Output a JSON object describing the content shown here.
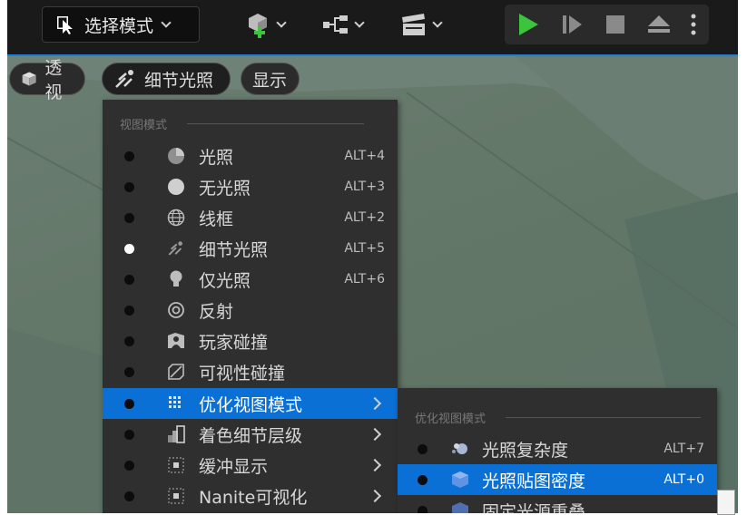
{
  "toolbar": {
    "mode_select_label": "选择模式",
    "icons": [
      "cursor-select-icon",
      "add-actor-icon",
      "blueprint-icon",
      "cinematics-clapper-icon"
    ],
    "play_controls": [
      "play-icon",
      "step-icon",
      "stop-icon",
      "eject-icon",
      "more-vertical-icon"
    ],
    "accent": "#1e7fd8",
    "play_color": "#3cc43c"
  },
  "viewport_chips": {
    "perspective": "透视",
    "lit": "细节光照",
    "show": "显示"
  },
  "view_mode_menu": {
    "header": "视图模式",
    "items": [
      {
        "label": "光照",
        "shortcut": "ALT+4",
        "icon": "lit-sphere-icon",
        "selected": false
      },
      {
        "label": "无光照",
        "shortcut": "ALT+3",
        "icon": "unlit-sphere-icon",
        "selected": false
      },
      {
        "label": "线框",
        "shortcut": "ALT+2",
        "icon": "wireframe-globe-icon",
        "selected": false
      },
      {
        "label": "细节光照",
        "shortcut": "ALT+5",
        "icon": "detail-lighting-icon",
        "selected": true
      },
      {
        "label": "仅光照",
        "shortcut": "ALT+6",
        "icon": "lightbulb-icon",
        "selected": false
      },
      {
        "label": "反射",
        "shortcut": "",
        "icon": "reflection-icon",
        "selected": false
      },
      {
        "label": "玩家碰撞",
        "shortcut": "",
        "icon": "player-collision-icon",
        "selected": false
      },
      {
        "label": "可视性碰撞",
        "shortcut": "",
        "icon": "visibility-collision-icon",
        "selected": false
      },
      {
        "label": "优化视图模式",
        "shortcut": "",
        "icon": "optimization-grid-icon",
        "selected": false,
        "submenu": true,
        "highlighted": true
      },
      {
        "label": "着色细节层级",
        "shortcut": "",
        "icon": "lod-coloration-icon",
        "selected": false,
        "submenu": true
      },
      {
        "label": "缓冲显示",
        "shortcut": "",
        "icon": "buffer-visualization-icon",
        "selected": false,
        "submenu": true
      },
      {
        "label": "Nanite可视化",
        "shortcut": "",
        "icon": "nanite-visualization-icon",
        "selected": false,
        "submenu": true
      }
    ]
  },
  "optimization_submenu": {
    "header": "优化视图模式",
    "items": [
      {
        "label": "光照复杂度",
        "shortcut": "ALT+7",
        "icon": "light-complexity-icon"
      },
      {
        "label": "光照贴图密度",
        "shortcut": "ALT+0",
        "icon": "lightmap-density-icon",
        "highlighted": true
      },
      {
        "label": "固定光源重叠",
        "shortcut": "",
        "icon": "stationary-light-overlap-icon"
      }
    ]
  },
  "colors": {
    "menu_bg": "#2f2f2f",
    "highlight": "#0a70d6",
    "viewport": "#637768"
  }
}
